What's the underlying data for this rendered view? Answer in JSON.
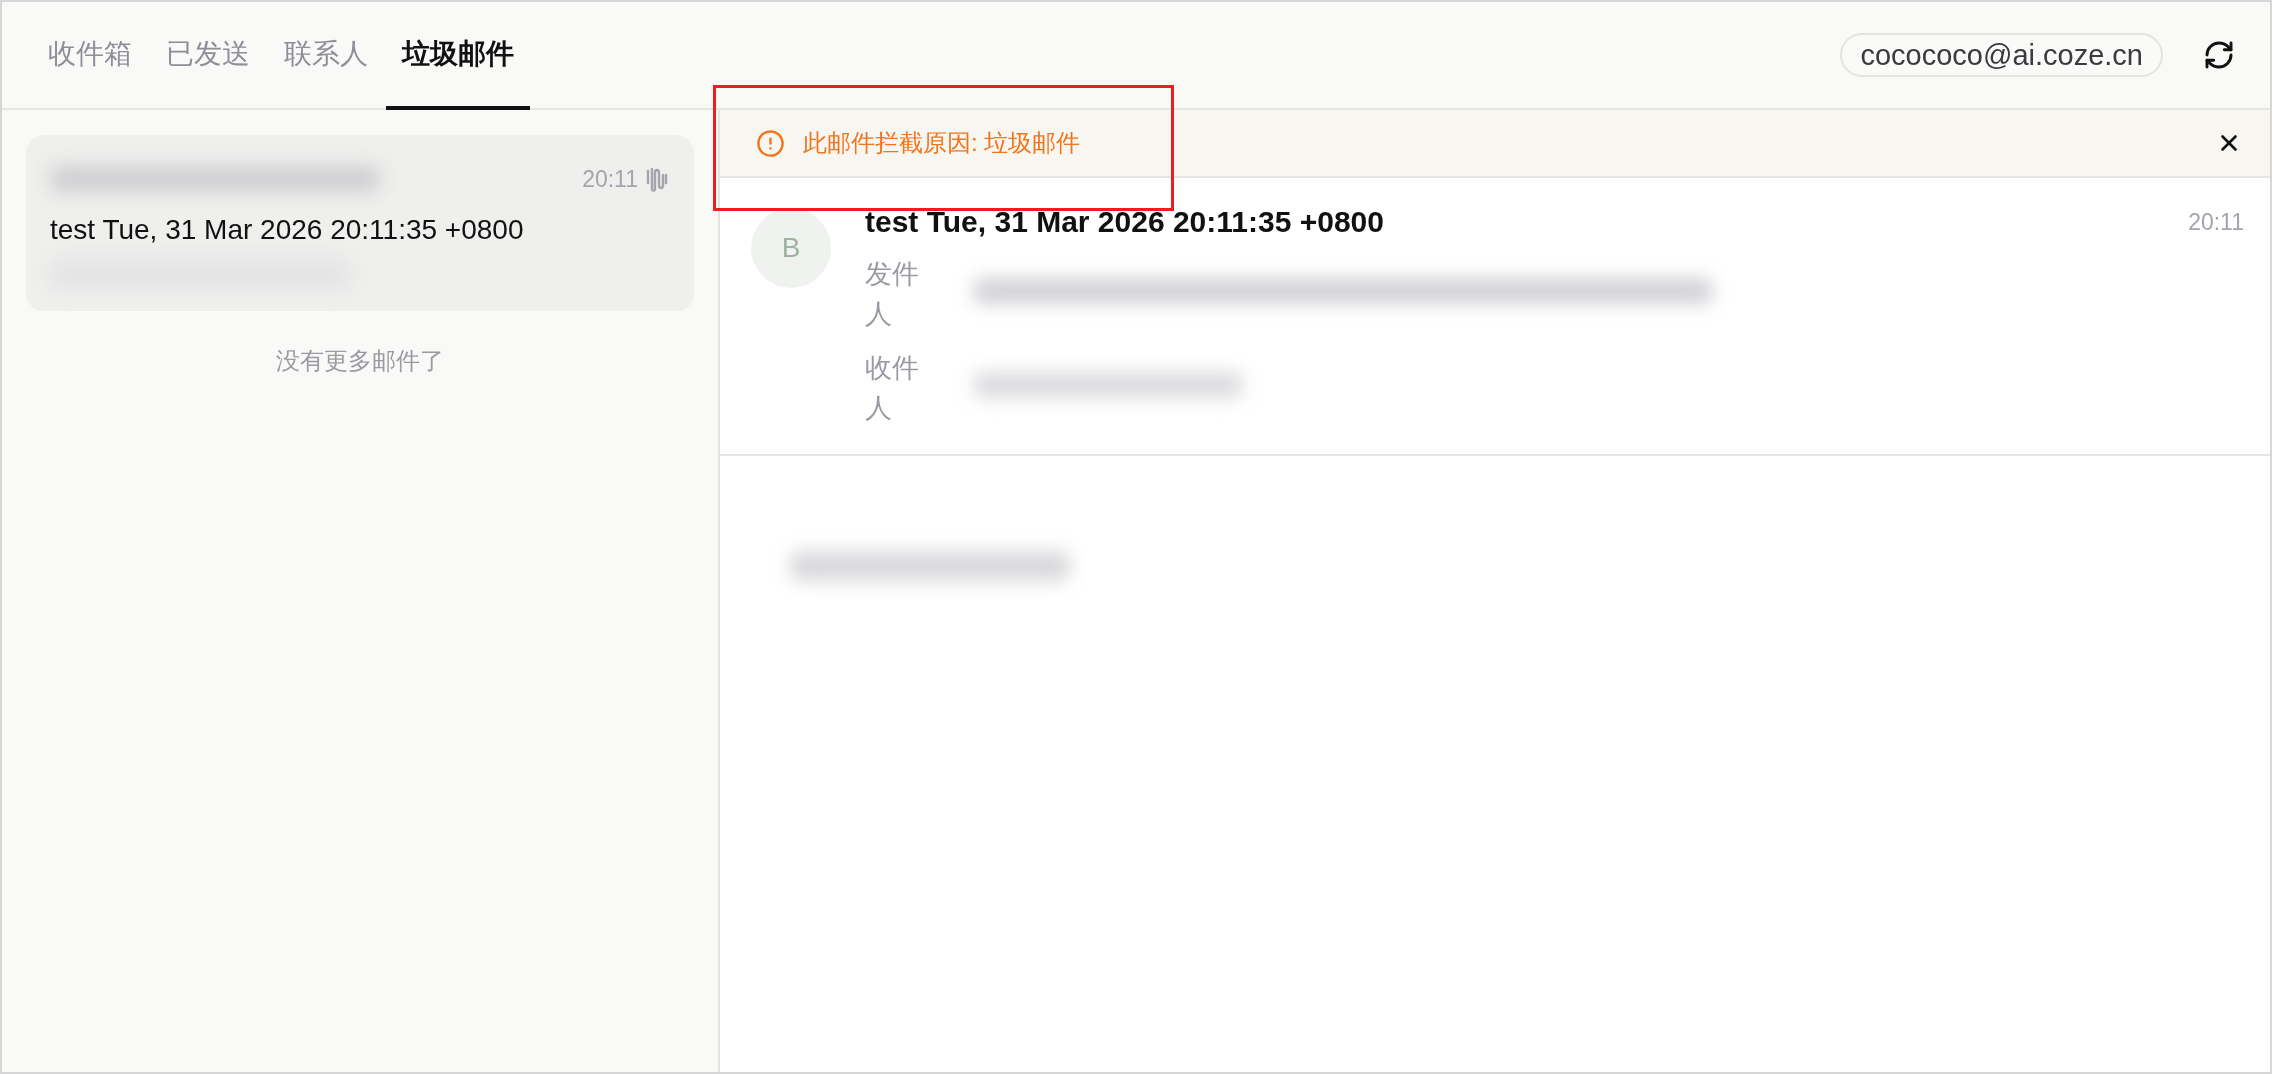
{
  "tabs": [
    {
      "label": "收件箱",
      "selected": false
    },
    {
      "label": "已发送",
      "selected": false
    },
    {
      "label": "联系人",
      "selected": false
    },
    {
      "label": "垃圾邮件",
      "selected": true
    }
  ],
  "account": {
    "email": "cocococo@ai.coze.cn"
  },
  "message_list": {
    "items": [
      {
        "time": "20:11",
        "subject": "test Tue, 31 Mar 2026 20:11:35 +0800",
        "selected": true
      }
    ],
    "end_note": "没有更多邮件了"
  },
  "notice": {
    "text": "此邮件拦截原因: 垃圾邮件"
  },
  "message": {
    "avatar_letter": "B",
    "subject": "test Tue, 31 Mar 2026 20:11:35 +0800",
    "time": "20:11",
    "fields": [
      {
        "label": "发件人"
      },
      {
        "label": "收件人"
      }
    ]
  }
}
